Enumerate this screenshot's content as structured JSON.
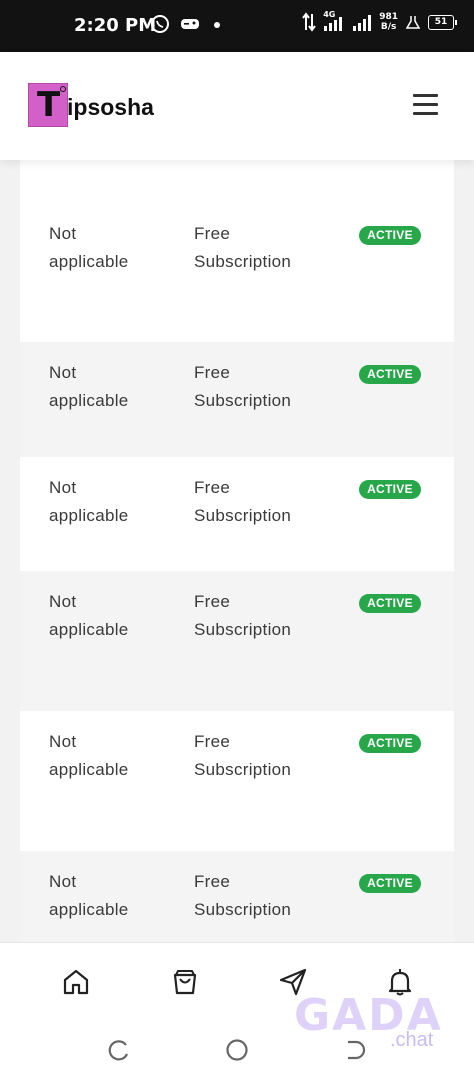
{
  "status_bar": {
    "time": "2:20 PM",
    "network": "4G",
    "speed_value": "981",
    "speed_unit": "B/s",
    "battery": "51"
  },
  "header": {
    "logo_letter": "T",
    "brand": "ipsosha",
    "menu_icon": "hamburger-icon"
  },
  "rows": [
    {
      "col1": "Not applicable",
      "col2": "Free Subscription",
      "status": "ACTIVE"
    },
    {
      "col1": "Not applicable",
      "col2": "Free Subscription",
      "status": "ACTIVE"
    },
    {
      "col1": "Not applicable",
      "col2": "Free Subscription",
      "status": "ACTIVE"
    },
    {
      "col1": "Not applicable",
      "col2": "Free Subscription",
      "status": "ACTIVE"
    },
    {
      "col1": "Not applicable",
      "col2": "Free Subscription",
      "status": "ACTIVE"
    },
    {
      "col1": "Not applicable",
      "col2": "Free Subscription",
      "status": "ACTIVE"
    }
  ],
  "bottom_nav": {
    "items": [
      "home-icon",
      "shopping-bag-icon",
      "send-icon",
      "bell-icon"
    ]
  },
  "watermark": {
    "main": "GADA",
    "sub": ".chat"
  },
  "colors": {
    "active_badge": "#27a74a",
    "logo_bg": "#d35fc8",
    "status_bar": "#121212"
  }
}
